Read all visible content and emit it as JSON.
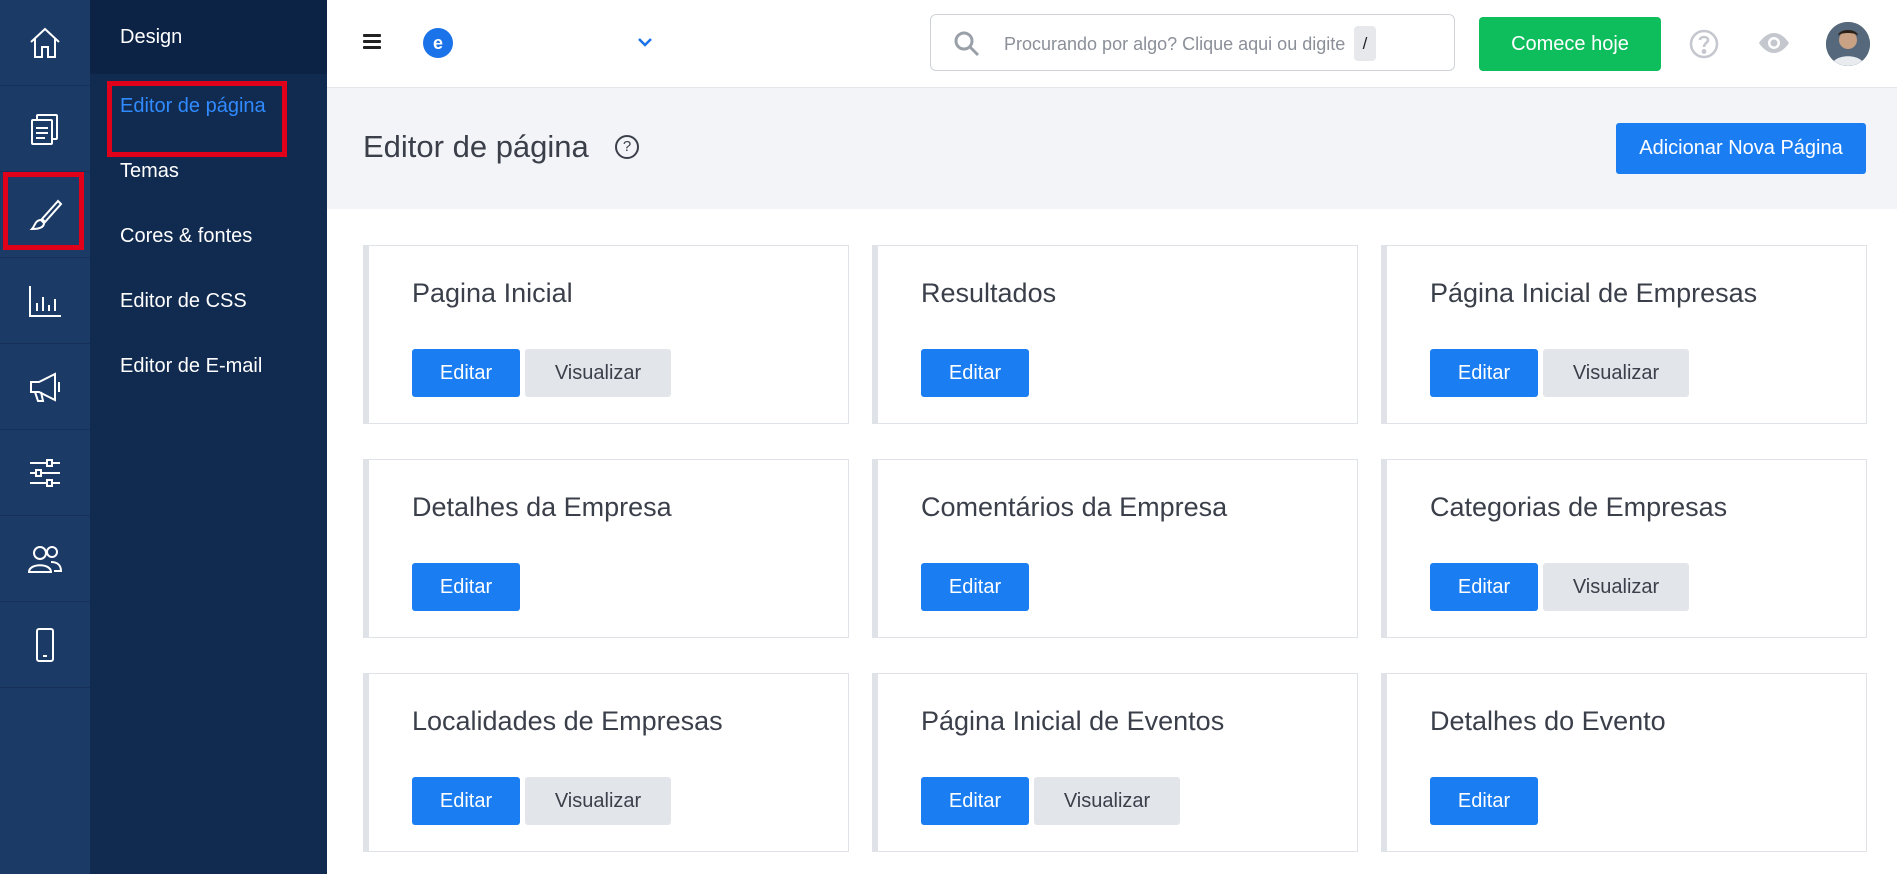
{
  "colors": {
    "rail_bg": "#1b3a66",
    "subnav_bg": "#112a4f",
    "primary": "#1a7ef2",
    "cta_green": "#0ebd5b",
    "highlight_red": "#e0001a"
  },
  "rail": {
    "items": [
      {
        "icon": "home-icon"
      },
      {
        "icon": "documents-icon"
      },
      {
        "icon": "brush-icon"
      },
      {
        "icon": "bar-chart-icon"
      },
      {
        "icon": "megaphone-icon"
      },
      {
        "icon": "sliders-icon"
      },
      {
        "icon": "users-icon"
      },
      {
        "icon": "mobile-icon"
      }
    ]
  },
  "subnav": {
    "title": "Design",
    "items": [
      {
        "label": "Editor de página"
      },
      {
        "label": "Temas"
      },
      {
        "label": "Cores & fontes"
      },
      {
        "label": "Editor de CSS"
      },
      {
        "label": "Editor de E-mail"
      }
    ]
  },
  "topbar": {
    "logo_letter": "e",
    "search_placeholder": "Procurando por algo? Clique aqui ou digite",
    "search_shortcut": "/",
    "cta_label": "Comece hoje"
  },
  "page": {
    "title": "Editor de página",
    "help_glyph": "?",
    "add_button": "Adicionar Nova Página"
  },
  "cards": [
    {
      "title": "Pagina Inicial",
      "edit": "Editar",
      "view": "Visualizar"
    },
    {
      "title": "Resultados",
      "edit": "Editar"
    },
    {
      "title": "Página Inicial de Empresas",
      "edit": "Editar",
      "view": "Visualizar"
    },
    {
      "title": "Detalhes da Empresa",
      "edit": "Editar"
    },
    {
      "title": "Comentários da Empresa",
      "edit": "Editar"
    },
    {
      "title": "Categorias de Empresas",
      "edit": "Editar",
      "view": "Visualizar"
    },
    {
      "title": "Localidades de Empresas",
      "edit": "Editar",
      "view": "Visualizar"
    },
    {
      "title": "Página Inicial de Eventos",
      "edit": "Editar",
      "view": "Visualizar"
    },
    {
      "title": "Detalhes do Evento",
      "edit": "Editar"
    }
  ]
}
